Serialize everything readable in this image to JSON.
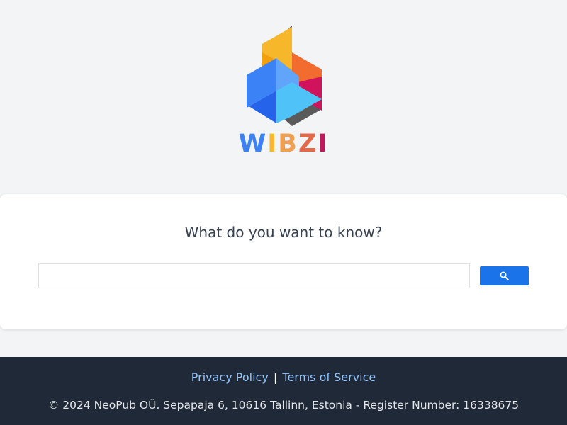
{
  "logo": {
    "letters": [
      {
        "char": "W",
        "color": "#3b82f6"
      },
      {
        "char": "I",
        "color": "#f5b82e"
      },
      {
        "char": "B",
        "color": "#f0a050"
      },
      {
        "char": "Z",
        "color": "#e26a4a"
      },
      {
        "char": "I",
        "color": "#c2185b"
      }
    ]
  },
  "search": {
    "prompt": "What do you want to know?",
    "input_value": "",
    "placeholder": "",
    "button_icon": "search-icon"
  },
  "footer": {
    "privacy_label": "Privacy Policy",
    "separator": "|",
    "terms_label": "Terms of Service",
    "copyright": "© 2024 NeoPub OÜ. Sepapaja 6, 10616 Tallinn, Estonia - Register Number: 16338675"
  },
  "colors": {
    "background": "#f3f4f6",
    "card": "#ffffff",
    "search_button": "#1a73e8",
    "footer_bg": "#1f2937",
    "footer_link": "#93c5fd"
  }
}
